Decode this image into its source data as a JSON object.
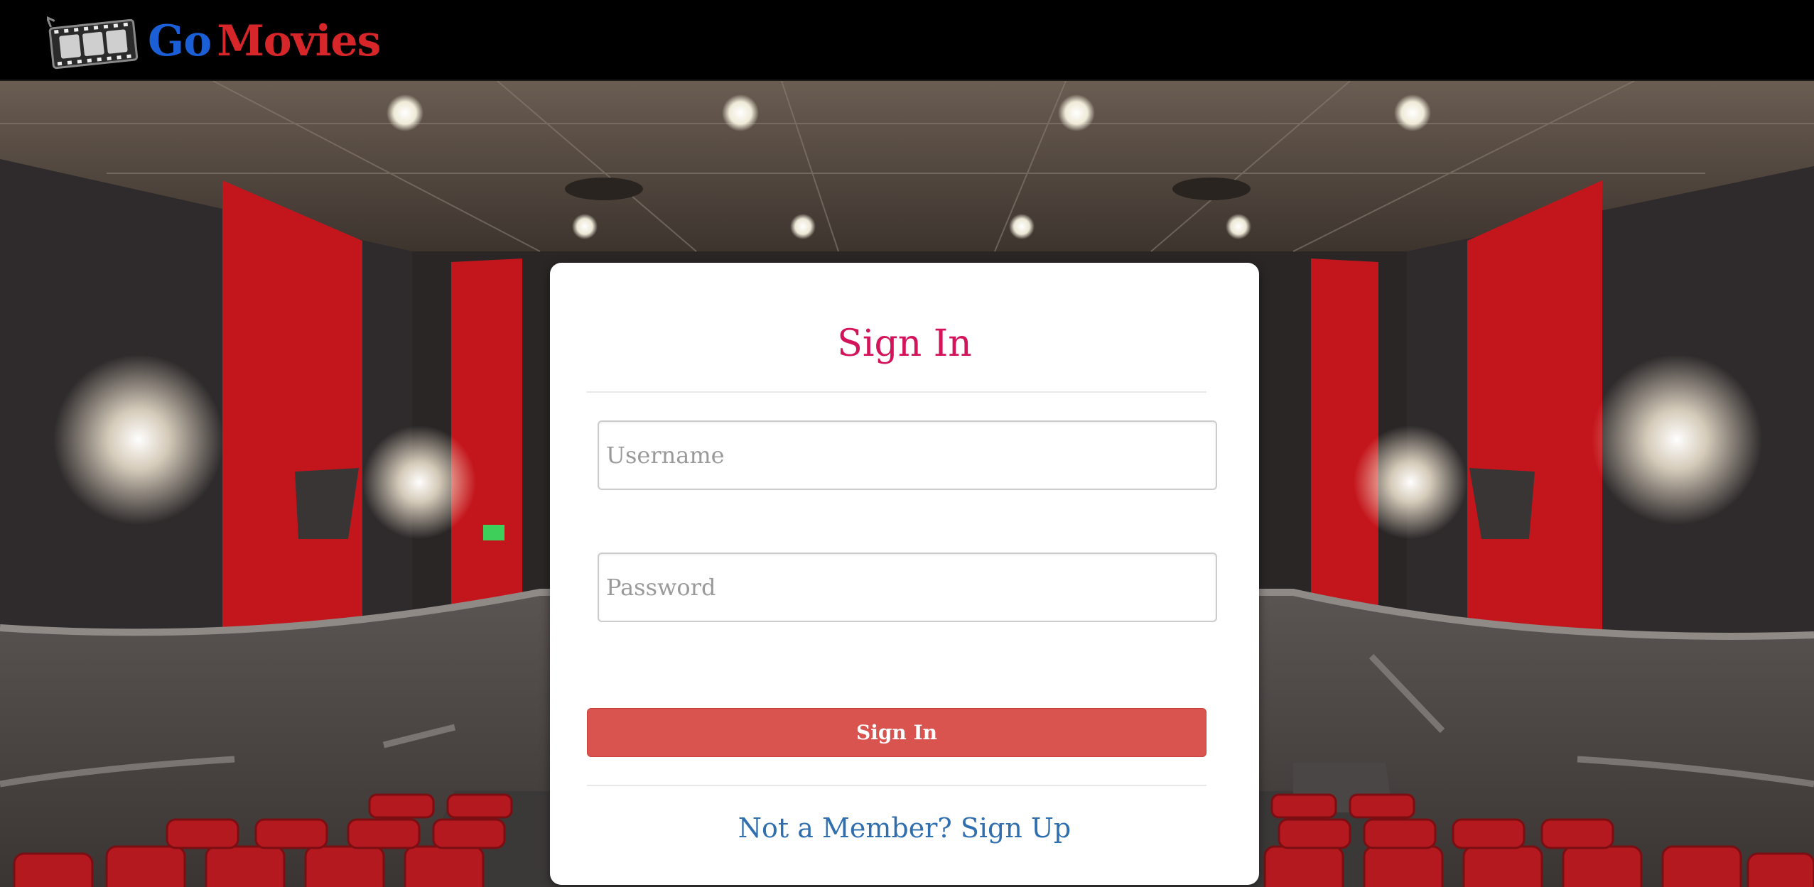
{
  "brand": {
    "logo_icon": "film-reel-icon",
    "name_part1": "Go",
    "name_part2": "Movies",
    "color_part1": "#1a5fd6",
    "color_part2": "#d6262a"
  },
  "background": {
    "description_icon": "theater-photo"
  },
  "login": {
    "title": "Sign In",
    "username_placeholder": "Username",
    "username_value": "",
    "password_placeholder": "Password",
    "password_value": "",
    "submit_label": "Sign In",
    "signup_link": "Not a Member? Sign Up",
    "accent_color": "#d4145a",
    "button_color": "#d9534f",
    "link_color": "#2f6eaf"
  }
}
